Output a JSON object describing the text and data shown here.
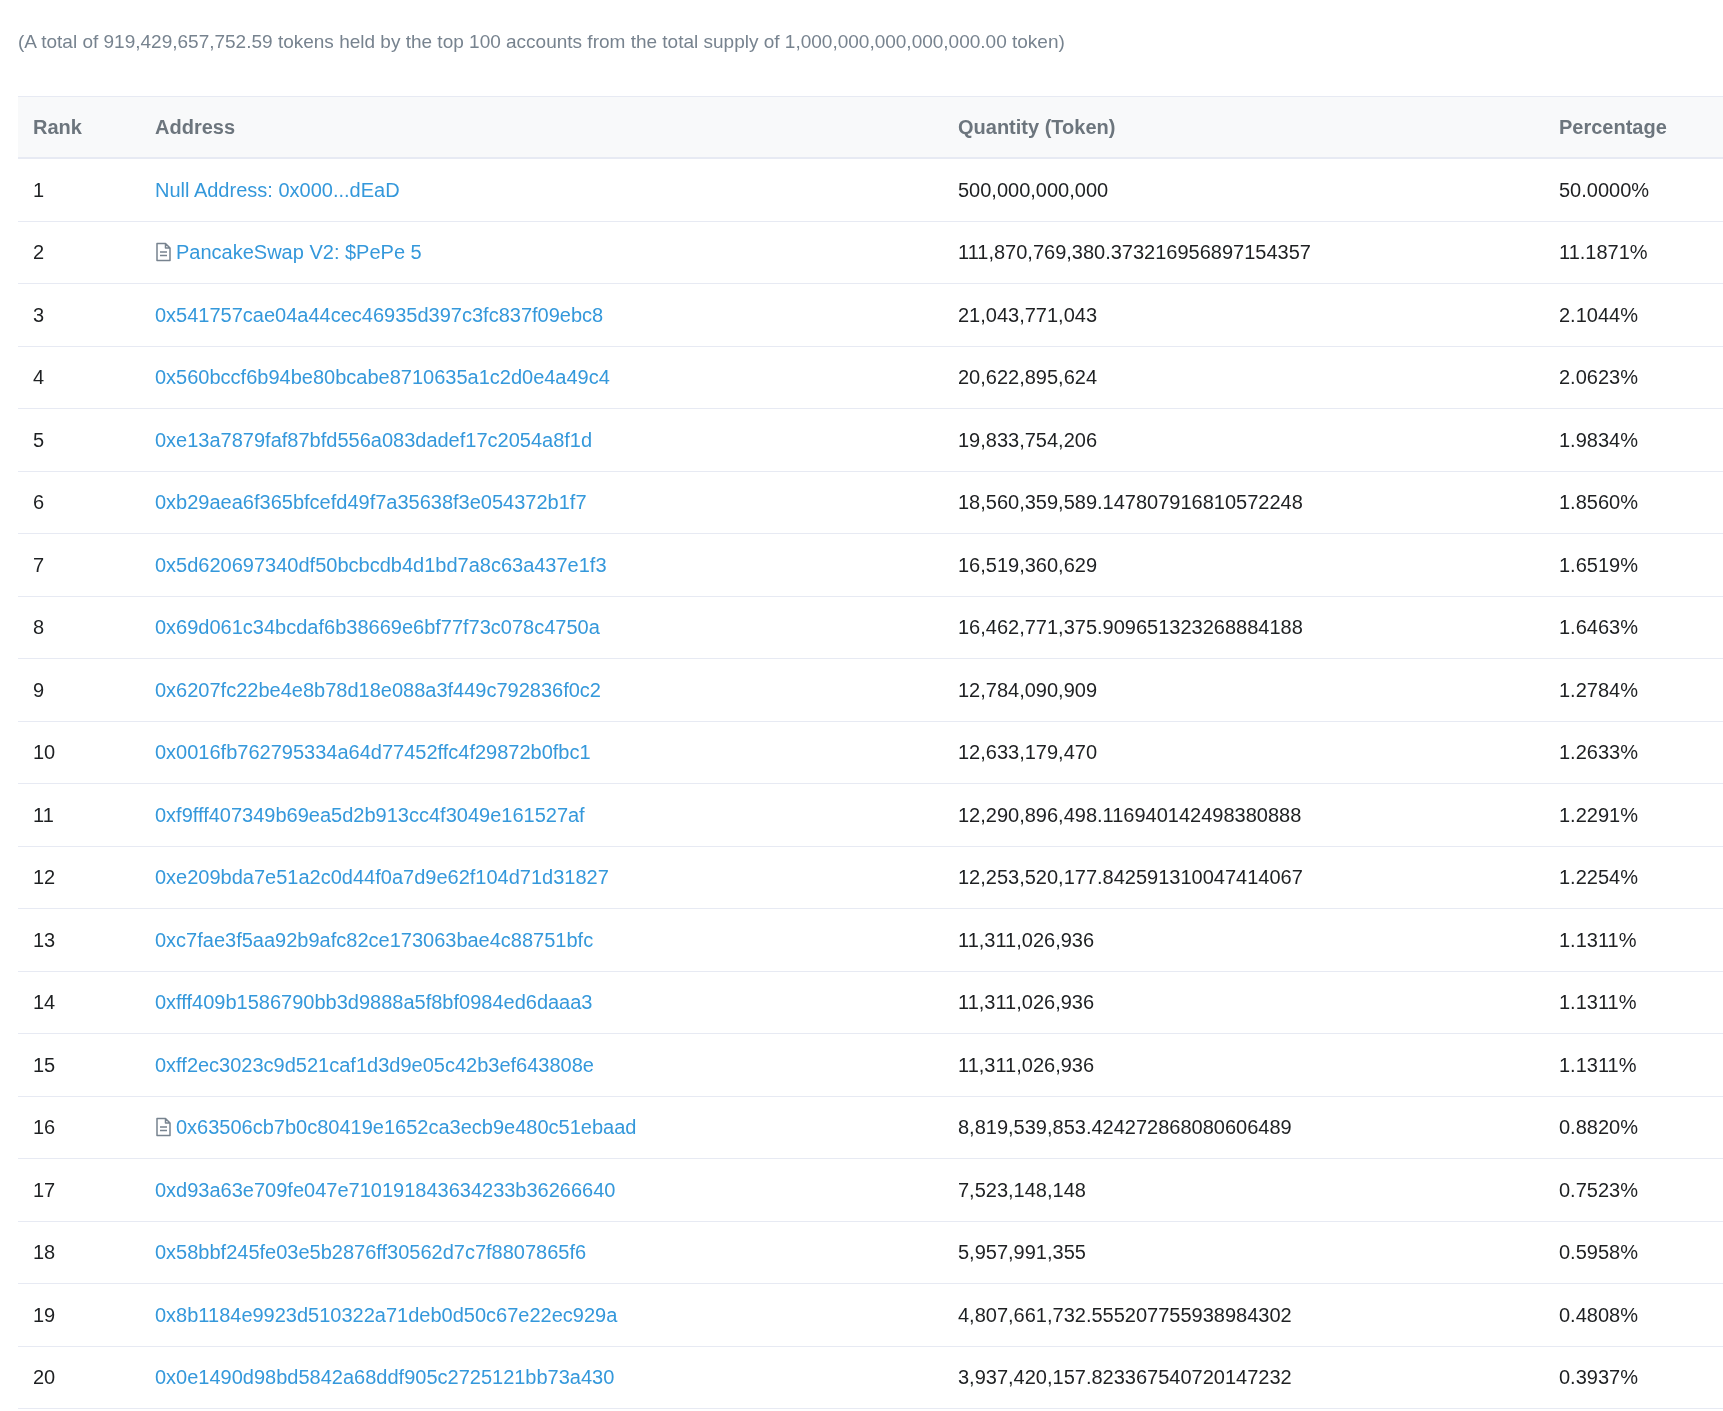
{
  "summary": "(A total of 919,429,657,752.59 tokens held by the top 100 accounts from the total supply of 1,000,000,000,000,000.00 token)",
  "table": {
    "columns": [
      "Rank",
      "Address",
      "Quantity (Token)",
      "Percentage"
    ],
    "rows": [
      {
        "rank": "1",
        "address": "Null Address: 0x000...dEaD",
        "contract": false,
        "quantity": "500,000,000,000",
        "percentage": "50.0000%"
      },
      {
        "rank": "2",
        "address": "PancakeSwap V2: $PePe 5",
        "contract": true,
        "quantity": "111,870,769,380.373216956897154357",
        "percentage": "11.1871%"
      },
      {
        "rank": "3",
        "address": "0x541757cae04a44cec46935d397c3fc837f09ebc8",
        "contract": false,
        "quantity": "21,043,771,043",
        "percentage": "2.1044%"
      },
      {
        "rank": "4",
        "address": "0x560bccf6b94be80bcabe8710635a1c2d0e4a49c4",
        "contract": false,
        "quantity": "20,622,895,624",
        "percentage": "2.0623%"
      },
      {
        "rank": "5",
        "address": "0xe13a7879faf87bfd556a083dadef17c2054a8f1d",
        "contract": false,
        "quantity": "19,833,754,206",
        "percentage": "1.9834%"
      },
      {
        "rank": "6",
        "address": "0xb29aea6f365bfcefd49f7a35638f3e054372b1f7",
        "contract": false,
        "quantity": "18,560,359,589.147807916810572248",
        "percentage": "1.8560%"
      },
      {
        "rank": "7",
        "address": "0x5d620697340df50bcbcdb4d1bd7a8c63a437e1f3",
        "contract": false,
        "quantity": "16,519,360,629",
        "percentage": "1.6519%"
      },
      {
        "rank": "8",
        "address": "0x69d061c34bcdaf6b38669e6bf77f73c078c4750a",
        "contract": false,
        "quantity": "16,462,771,375.909651323268884188",
        "percentage": "1.6463%"
      },
      {
        "rank": "9",
        "address": "0x6207fc22be4e8b78d18e088a3f449c792836f0c2",
        "contract": false,
        "quantity": "12,784,090,909",
        "percentage": "1.2784%"
      },
      {
        "rank": "10",
        "address": "0x0016fb762795334a64d77452ffc4f29872b0fbc1",
        "contract": false,
        "quantity": "12,633,179,470",
        "percentage": "1.2633%"
      },
      {
        "rank": "11",
        "address": "0xf9fff407349b69ea5d2b913cc4f3049e161527af",
        "contract": false,
        "quantity": "12,290,896,498.116940142498380888",
        "percentage": "1.2291%"
      },
      {
        "rank": "12",
        "address": "0xe209bda7e51a2c0d44f0a7d9e62f104d71d31827",
        "contract": false,
        "quantity": "12,253,520,177.842591310047414067",
        "percentage": "1.2254%"
      },
      {
        "rank": "13",
        "address": "0xc7fae3f5aa92b9afc82ce173063bae4c88751bfc",
        "contract": false,
        "quantity": "11,311,026,936",
        "percentage": "1.1311%"
      },
      {
        "rank": "14",
        "address": "0xfff409b1586790bb3d9888a5f8bf0984ed6daaa3",
        "contract": false,
        "quantity": "11,311,026,936",
        "percentage": "1.1311%"
      },
      {
        "rank": "15",
        "address": "0xff2ec3023c9d521caf1d3d9e05c42b3ef643808e",
        "contract": false,
        "quantity": "11,311,026,936",
        "percentage": "1.1311%"
      },
      {
        "rank": "16",
        "address": "0x63506cb7b0c80419e1652ca3ecb9e480c51ebaad",
        "contract": true,
        "quantity": "8,819,539,853.424272868080606489",
        "percentage": "0.8820%"
      },
      {
        "rank": "17",
        "address": "0xd93a63e709fe047e710191843634233b36266640",
        "contract": false,
        "quantity": "7,523,148,148",
        "percentage": "0.7523%"
      },
      {
        "rank": "18",
        "address": "0x58bbf245fe03e5b2876ff30562d7c7f8807865f6",
        "contract": false,
        "quantity": "5,957,991,355",
        "percentage": "0.5958%"
      },
      {
        "rank": "19",
        "address": "0x8b1184e9923d510322a71deb0d50c67e22ec929a",
        "contract": false,
        "quantity": "4,807,661,732.555207755938984302",
        "percentage": "0.4808%"
      },
      {
        "rank": "20",
        "address": "0x0e1490d98bd5842a68ddf905c2725121bb73a430",
        "contract": false,
        "quantity": "3,937,420,157.823367540720147232",
        "percentage": "0.3937%"
      }
    ]
  }
}
